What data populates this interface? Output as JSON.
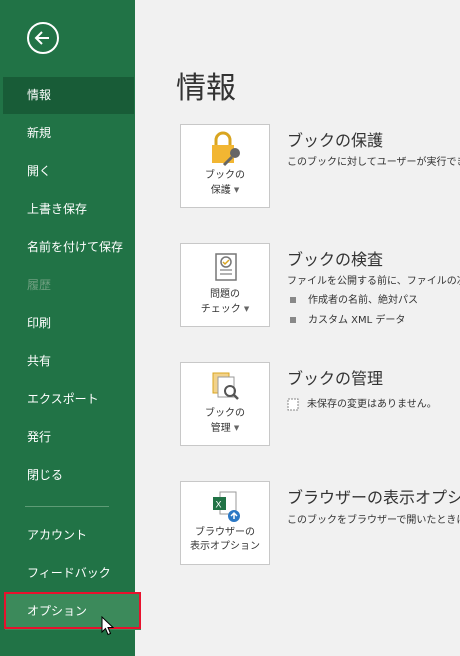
{
  "sidebar": {
    "back_icon": "arrow-left-circle-icon",
    "items": [
      {
        "label": "情報"
      },
      {
        "label": "新規"
      },
      {
        "label": "開く"
      },
      {
        "label": "上書き保存"
      },
      {
        "label": "名前を付けて保存"
      },
      {
        "label": "履歴"
      },
      {
        "label": "印刷"
      },
      {
        "label": "共有"
      },
      {
        "label": "エクスポート"
      },
      {
        "label": "発行"
      },
      {
        "label": "閉じる"
      },
      {
        "label": "アカウント"
      },
      {
        "label": "フィードバック"
      },
      {
        "label": "オプション"
      }
    ],
    "active": "情報",
    "disabled": "履歴",
    "highlighted": "オプション"
  },
  "main": {
    "title": "情報",
    "sections": [
      {
        "tile_line1": "ブックの",
        "tile_line2": "保護",
        "title": "ブックの保護",
        "desc": "このブックに対してユーザーが実行でき",
        "icon": "lock-key-icon"
      },
      {
        "tile_line1": "問題の",
        "tile_line2": "チェック",
        "title": "ブックの検査",
        "desc": "ファイルを公開する前に、ファイルの次",
        "bullets": [
          "作成者の名前、絶対パス",
          "カスタム XML データ"
        ],
        "icon": "checklist-icon"
      },
      {
        "tile_line1": "ブックの",
        "tile_line2": "管理",
        "title": "ブックの管理",
        "desc": "未保存の変更はありません。",
        "icon": "manage-workbook-icon"
      },
      {
        "tile_line1": "ブラウザーの",
        "tile_line2": "表示オプション",
        "title": "ブラウザーの表示オプシ",
        "desc": "このブックをブラウザーで開いたときに表",
        "icon": "excel-browser-icon"
      }
    ]
  },
  "colors": {
    "sidebar": "#217346",
    "sidebar_active": "#185c37",
    "highlight": "#e8112d",
    "background": "#f1f1f1"
  }
}
